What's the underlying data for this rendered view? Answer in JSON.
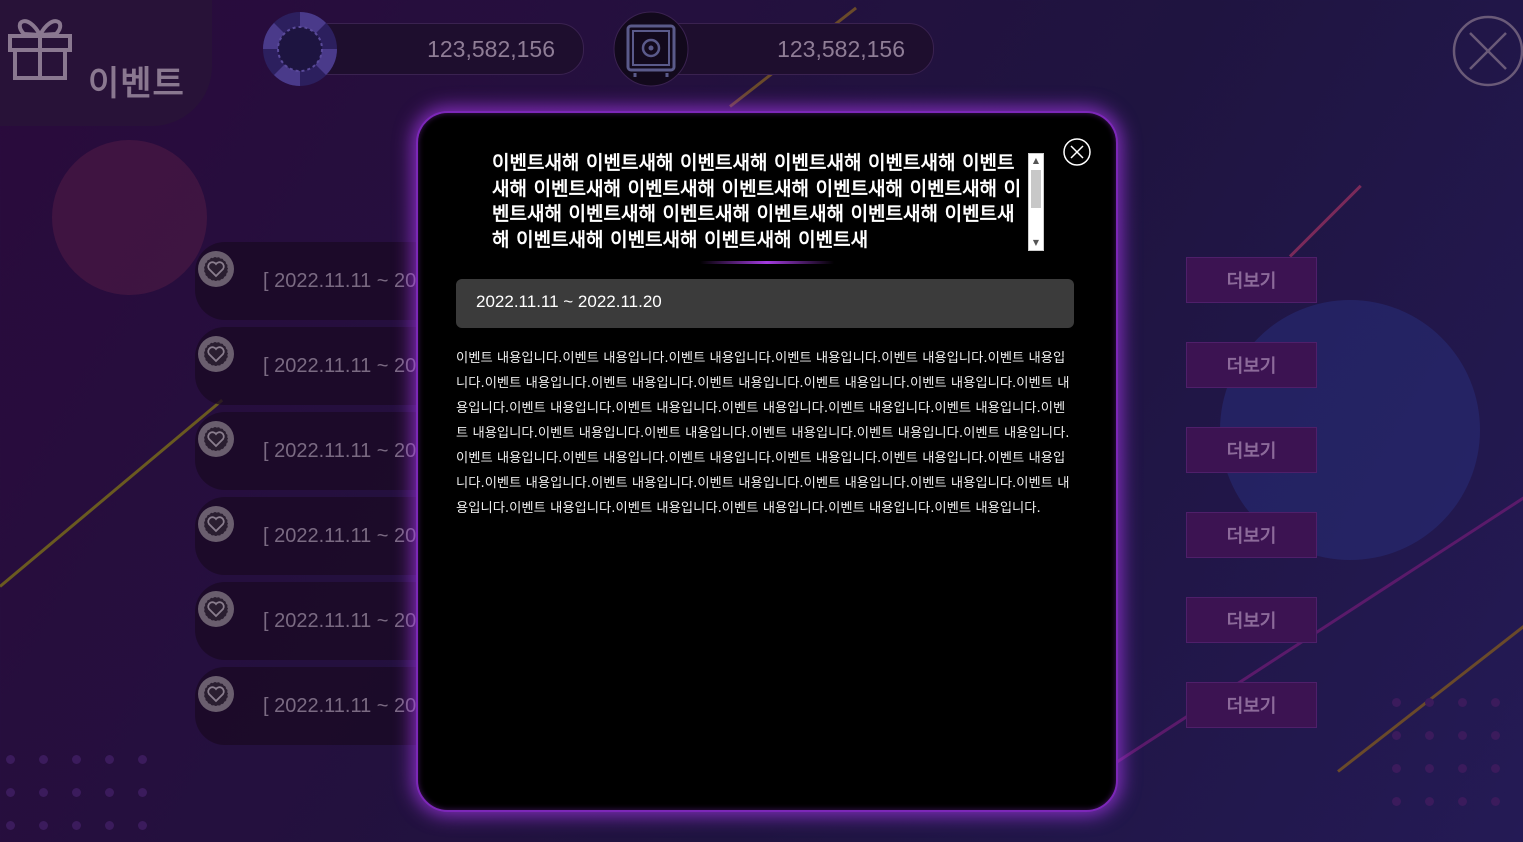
{
  "page": {
    "title": "이벤트"
  },
  "balances": [
    {
      "icon": "poker-chip-icon",
      "value": "123,582,156"
    },
    {
      "icon": "safe-icon",
      "value": "123,582,156"
    }
  ],
  "event_list": [
    {
      "date": "[ 2022.11.11 ~ 20",
      "more_label": "더보기"
    },
    {
      "date": "[ 2022.11.11 ~ 20",
      "more_label": "더보기"
    },
    {
      "date": "[ 2022.11.11 ~ 20",
      "more_label": "더보기"
    },
    {
      "date": "[ 2022.11.11 ~ 20",
      "more_label": "더보기"
    },
    {
      "date": "[ 2022.11.11 ~ 20",
      "more_label": "더보기"
    },
    {
      "date": "[ 2022.11.11 ~ 20",
      "more_label": "더보기"
    }
  ],
  "modal": {
    "title": "이벤트새해 이벤트새해 이벤트새해 이벤트새해 이벤트새해 이벤트새해 이벤트새해 이벤트새해 이벤트새해 이벤트새해 이벤트새해 이벤트새해 이벤트새해 이벤트새해 이벤트새해 이벤트새해 이벤트새해 이벤트새해 이벤트새해 이벤트새해 이벤트새",
    "date_range": "2022.11.11 ~ 2022.11.20",
    "body": "이벤트 내용입니다.이벤트 내용입니다.이벤트 내용입니다.이벤트 내용입니다.이벤트 내용입니다.이벤트 내용입니다.이벤트 내용입니다.이벤트 내용입니다.이벤트 내용입니다.이벤트 내용입니다.이벤트 내용입니다.이벤트 내용입니다.이벤트 내용입니다.이벤트 내용입니다.이벤트 내용입니다.이벤트 내용입니다.이벤트 내용입니다.이벤트 내용입니다.이벤트 내용입니다.이벤트 내용입니다.이벤트 내용입니다.이벤트 내용입니다.이벤트 내용입니다.이벤트 내용입니다.이벤트 내용입니다.이벤트 내용입니다.이벤트 내용입니다.이벤트 내용입니다.이벤트 내용입니다.이벤트 내용입니다.이벤트 내용입니다.이벤트 내용입니다.이벤트 내용입니다.이벤트 내용입니다.이벤트 내용입니다.이벤트 내용입니다.이벤트 내용입니다.이벤트 내용입니다.이벤트 내용입니다.이벤트 내용입니다."
  },
  "colors": {
    "accent": "#a43be0",
    "button_bg": "#3c1352",
    "background": "#24103e"
  }
}
